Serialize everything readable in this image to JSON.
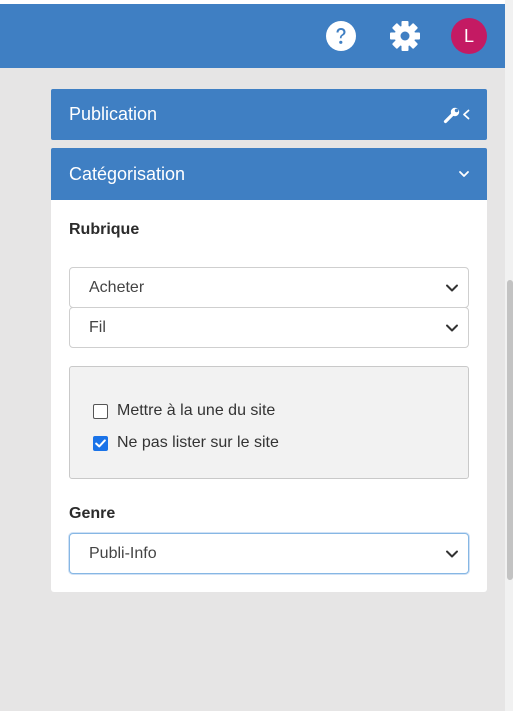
{
  "topbar": {
    "help_icon": "question-circle-icon",
    "settings_icon": "gear-icon",
    "avatar_initial": "L",
    "avatar_color": "#c41a63",
    "background": "#3f7fc3"
  },
  "panels": {
    "publication": {
      "title": "Publication",
      "icon": "wrench-chevron-left-icon"
    },
    "categorisation": {
      "title": "Catégorisation",
      "icon": "chevron-down-icon"
    }
  },
  "rubrique": {
    "label": "Rubrique",
    "select1_value": "Acheter",
    "select2_value": "Fil"
  },
  "options": {
    "une_du_site": {
      "label": "Mettre à la une du site",
      "checked": false
    },
    "ne_pas_lister": {
      "label": "Ne pas lister sur le site",
      "checked": true
    }
  },
  "genre": {
    "label": "Genre",
    "value": "Publi-Info"
  }
}
